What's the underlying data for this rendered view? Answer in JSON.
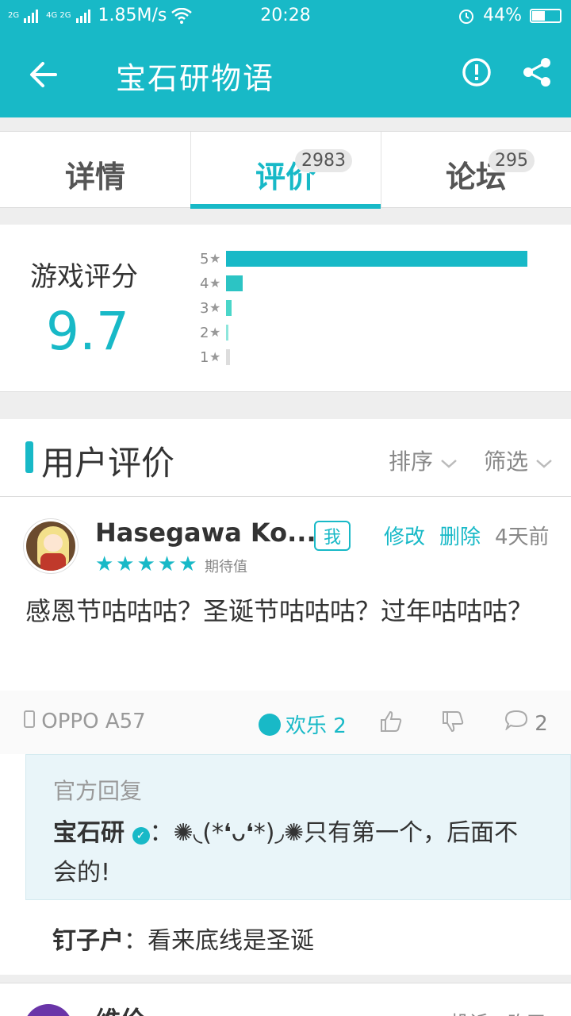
{
  "status_bar": {
    "network_labels": [
      "2G",
      "4G 2G"
    ],
    "speed": "1.85M/s",
    "time": "20:28",
    "battery": "44%"
  },
  "app_bar": {
    "title": "宝石研物语"
  },
  "tabs": [
    {
      "label": "详情",
      "badge": ""
    },
    {
      "label": "评价",
      "badge": "2983"
    },
    {
      "label": "论坛",
      "badge": "295"
    }
  ],
  "rating": {
    "label": "游戏评分",
    "score": "9.7",
    "distribution": [
      {
        "star": "5",
        "fraction": 1.0,
        "color": "#18b9c7"
      },
      {
        "star": "4",
        "fraction": 0.055,
        "color": "#2cc4c4"
      },
      {
        "star": "3",
        "fraction": 0.018,
        "color": "#4ad6c9"
      },
      {
        "star": "2",
        "fraction": 0.003,
        "color": "#8ee6dc"
      },
      {
        "star": "1",
        "fraction": 0.013,
        "color": "#dddddd"
      }
    ]
  },
  "reviews_section": {
    "title": "用户评价",
    "sort_label": "排序",
    "filter_label": "筛选"
  },
  "review": {
    "username": "Hasegawa Ko...",
    "me_badge": "我",
    "edit_label": "修改",
    "delete_label": "删除",
    "time": "4天前",
    "stars": "★★★★★",
    "star_label": "期待值",
    "text": "感恩节咕咕咕？圣诞节咕咕咕？过年咕咕咕？",
    "device": "OPPO A57",
    "reaction": "欢乐 2",
    "comment_count": "2",
    "official_label": "官方回复",
    "official_name": "宝石研",
    "official_text": "：✺◟(*❛ᴗ❛*)◞✺只有第一个，后面不会的!",
    "reply_name": "钉子户",
    "reply_text": "：看来底线是圣诞"
  },
  "next_review": {
    "username": "维伦",
    "report_label": "投诉",
    "time": "昨天"
  }
}
